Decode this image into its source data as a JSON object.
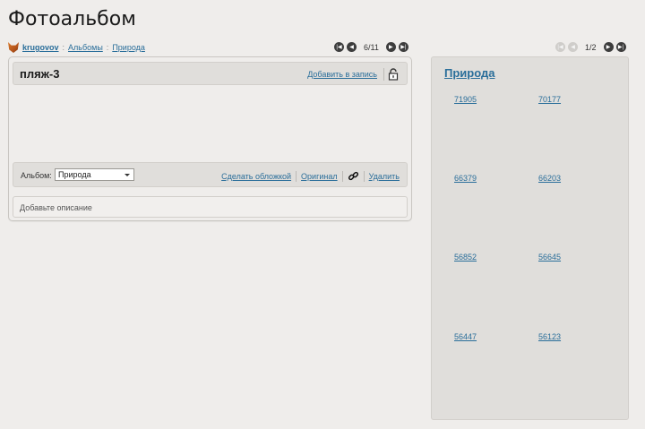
{
  "page": {
    "title": "Фотоальбом"
  },
  "breadcrumb": {
    "user": "krugovov",
    "albums": "Альбомы",
    "album": "Природа",
    "separator": ":"
  },
  "photo_pager": {
    "current": "6/11"
  },
  "album_pager": {
    "current": "1/2"
  },
  "photo": {
    "title": "пляж-3",
    "add_to_post": "Добавить в запись",
    "album_label": "Альбом:",
    "album_selected": "Природа",
    "make_cover": "Сделать обложкой",
    "original": "Оригинал",
    "delete": "Удалить",
    "description_placeholder": "Добавьте описание"
  },
  "album": {
    "title": "Природа",
    "thumbnails": [
      "71905",
      "70177",
      "66379",
      "66203",
      "56852",
      "56645",
      "56447",
      "56123"
    ]
  },
  "colors": {
    "link": "#2a6e9a",
    "panel": "#e0dedb",
    "background": "#efedeb"
  }
}
